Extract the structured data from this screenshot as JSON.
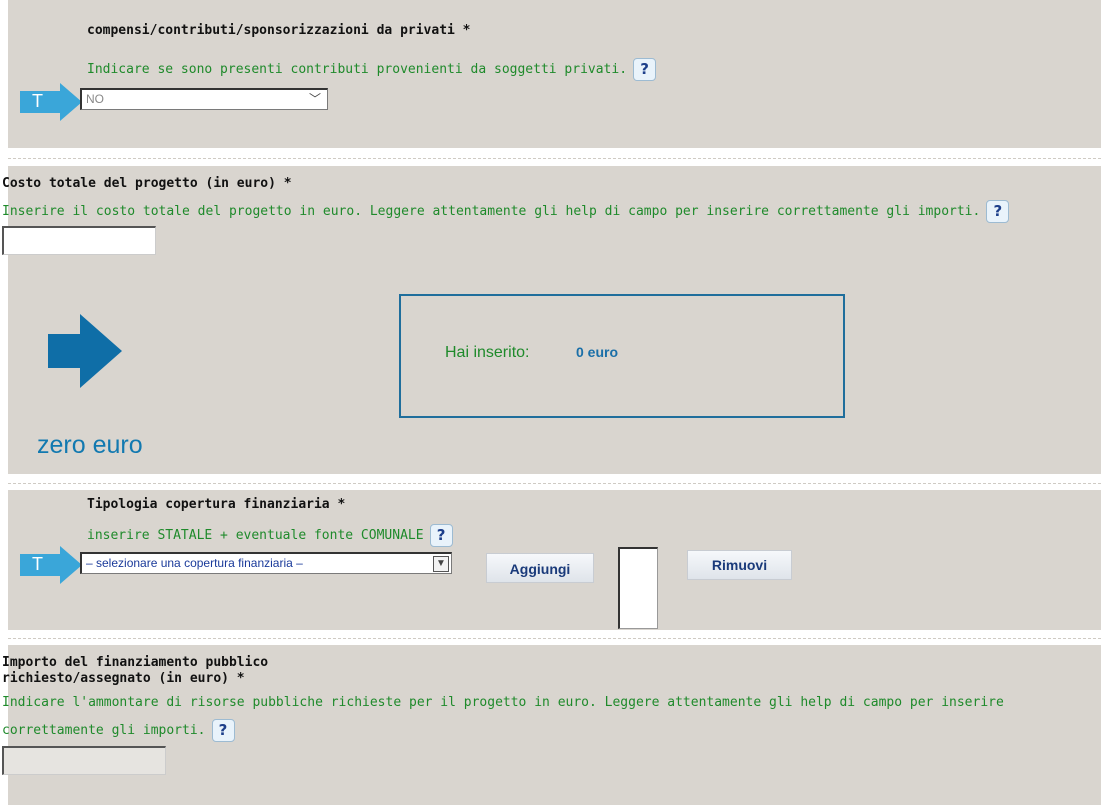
{
  "section1": {
    "label": "compensi/contributi/sponsorizzazioni da privati *",
    "hint": "Indicare se sono presenti contributi provenienti da soggetti privati.",
    "help_label": "?",
    "indicator": "T",
    "select_value": "NO"
  },
  "section2": {
    "label": "Costo totale del progetto (in euro) *",
    "hint": "Inserire il costo totale del progetto in euro. Leggere attentamente gli help di campo per inserire correttamente gli importi.",
    "help_label": "?",
    "input_value": "",
    "result_prefix": "Hai inserito:",
    "result_value": "0 euro",
    "caption": "zero euro"
  },
  "section3": {
    "label": "Tipologia copertura finanziaria *",
    "hint": "inserire STATALE + eventuale fonte COMUNALE",
    "help_label": "?",
    "indicator": "T",
    "select_value": "– selezionare una copertura finanziaria –",
    "add_label": "Aggiungi",
    "remove_label": "Rimuovi"
  },
  "section4": {
    "label_line1": "Importo del finanziamento pubblico",
    "label_line2": "richiesto/assegnato (in euro) *",
    "hint_line1": "Indicare l'ammontare di risorse pubbliche richieste per il progetto in euro. Leggere attentamente gli help di campo per inserire",
    "hint_line2": "correttamente gli importi.",
    "help_label": "?",
    "input_value": ""
  },
  "colors": {
    "panel": "#d9d5cf",
    "hint_green": "#1f8a2b",
    "arrow_light_blue": "#3aa6d9",
    "arrow_dark_blue": "#0f6ea7",
    "caption_blue": "#1279b0"
  },
  "icons": {
    "t_indicator": "light-blue-right-arrow-with-T",
    "big_arrow": "dark-blue-right-arrow",
    "help": "question-mark-help-icon",
    "dropdown": "chevron-down-icon"
  }
}
